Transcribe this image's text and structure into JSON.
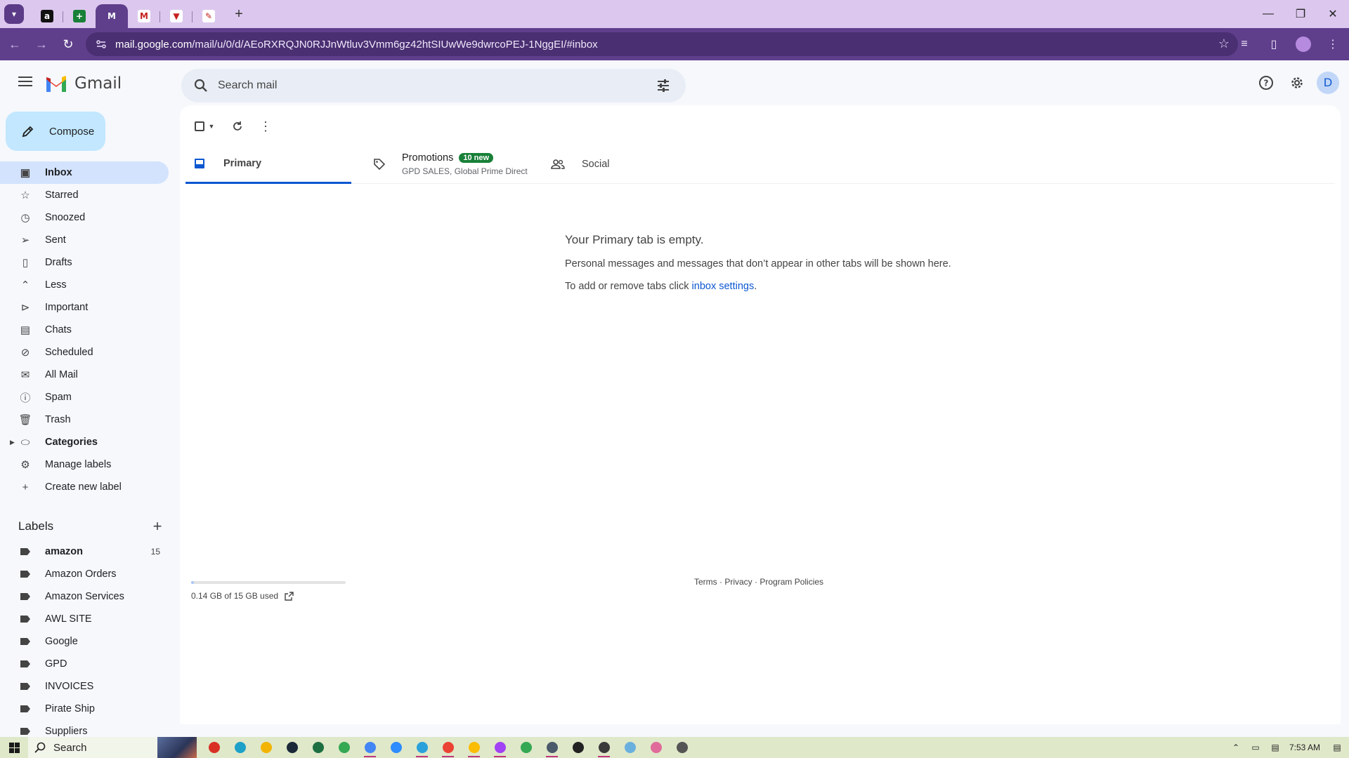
{
  "browser": {
    "tabs": [
      {
        "name": "amazon-tab",
        "glyph": "a",
        "color": "#111111",
        "active": false
      },
      {
        "name": "sheets-tab",
        "glyph": "+",
        "color": "#188038",
        "active": false
      },
      {
        "name": "gmail-tab",
        "glyph": "M",
        "color": "#5f3f8c",
        "active": true
      },
      {
        "name": "gmail-tab-2",
        "glyph": "M",
        "color": "#ffffff",
        "active": false
      },
      {
        "name": "app-tab",
        "glyph": "▼",
        "color": "#ffffff",
        "active": false
      },
      {
        "name": "app-tab-2",
        "glyph": "✎",
        "color": "#ffffff",
        "active": false
      }
    ],
    "url_host": "mail.google.com",
    "url_path": "/mail/u/0/d/AEoRXRQJN0RJJnWtluv3Vmm6gz42htSIUwWe9dwrcoPEJ-1NggEI/#inbox"
  },
  "gmail": {
    "logo_text": "Gmail",
    "search_placeholder": "Search mail",
    "avatar_letter": "D"
  },
  "sidebar": {
    "compose_label": "Compose",
    "items": [
      {
        "label": "Inbox",
        "icon": "inbox-icon",
        "active": true
      },
      {
        "label": "Starred",
        "icon": "star-icon"
      },
      {
        "label": "Snoozed",
        "icon": "clock-icon"
      },
      {
        "label": "Sent",
        "icon": "send-icon"
      },
      {
        "label": "Drafts",
        "icon": "draft-icon"
      },
      {
        "label": "Less",
        "icon": "chevron-up-icon"
      },
      {
        "label": "Important",
        "icon": "important-icon"
      },
      {
        "label": "Chats",
        "icon": "chat-icon"
      },
      {
        "label": "Scheduled",
        "icon": "scheduled-icon"
      },
      {
        "label": "All Mail",
        "icon": "all-mail-icon"
      },
      {
        "label": "Spam",
        "icon": "spam-icon"
      },
      {
        "label": "Trash",
        "icon": "trash-icon"
      },
      {
        "label": "Categories",
        "icon": "label-outline-icon",
        "bold": true
      },
      {
        "label": "Manage labels",
        "icon": "gear-icon"
      },
      {
        "label": "Create new label",
        "icon": "plus-icon"
      }
    ],
    "labels_title": "Labels",
    "labels": [
      {
        "label": "amazon",
        "count": "15",
        "bold": true
      },
      {
        "label": "Amazon Orders"
      },
      {
        "label": "Amazon Services"
      },
      {
        "label": "AWL SITE"
      },
      {
        "label": "Google"
      },
      {
        "label": "GPD"
      },
      {
        "label": "INVOICES"
      },
      {
        "label": "Pirate Ship"
      },
      {
        "label": "Suppliers"
      }
    ]
  },
  "main": {
    "tabs": {
      "primary": "Primary",
      "promotions": "Promotions",
      "promotions_badge": "10 new",
      "promotions_sub": "GPD SALES, Global Prime Direct",
      "social": "Social"
    },
    "empty_title": "Your Primary tab is empty.",
    "empty_line1": "Personal messages and messages that don’t appear in other tabs will be shown here.",
    "empty_line2_prefix": "To add or remove tabs click ",
    "empty_line2_link": "inbox settings",
    "empty_line2_suffix": ".",
    "storage_text": "0.14 GB of 15 GB used",
    "storage_fraction": 0.01,
    "footer_terms": "Terms",
    "footer_privacy": "Privacy",
    "footer_policies": "Program Policies",
    "footer_sep": " · "
  },
  "taskbar": {
    "search_label": "Search",
    "time": "7:53 AM",
    "apps": [
      {
        "name": "red-app",
        "color": "#d93025",
        "open": false
      },
      {
        "name": "edge-app",
        "color": "#1da1c9",
        "open": false
      },
      {
        "name": "folder-app",
        "color": "#f2b400",
        "open": false
      },
      {
        "name": "steam-app",
        "color": "#1b2838",
        "open": false
      },
      {
        "name": "excel-app",
        "color": "#1d6f42",
        "open": false
      },
      {
        "name": "chrome-app",
        "color": "#34a853",
        "open": false
      },
      {
        "name": "chrome-app-2",
        "color": "#4285f4",
        "open": true
      },
      {
        "name": "zoom-app",
        "color": "#2d8cff",
        "open": false
      },
      {
        "name": "telegram-app",
        "color": "#2aa1da",
        "open": true
      },
      {
        "name": "chrome-app-3",
        "color": "#ea4335",
        "open": true
      },
      {
        "name": "chrome-app-4",
        "color": "#fbbc04",
        "open": true
      },
      {
        "name": "chrome-app-5",
        "color": "#a142f4",
        "open": true
      },
      {
        "name": "chrome-app-6",
        "color": "#34a853",
        "open": false
      },
      {
        "name": "calculator-app",
        "color": "#4a5a6a",
        "open": true
      },
      {
        "name": "obs-app",
        "color": "#222222",
        "open": false
      },
      {
        "name": "terminal-app",
        "color": "#3a3a3a",
        "open": true
      },
      {
        "name": "notepad-app",
        "color": "#6ab0de",
        "open": false
      },
      {
        "name": "paint-app",
        "color": "#e06b9a",
        "open": false
      },
      {
        "name": "settings-app",
        "color": "#555555",
        "open": false
      }
    ]
  }
}
